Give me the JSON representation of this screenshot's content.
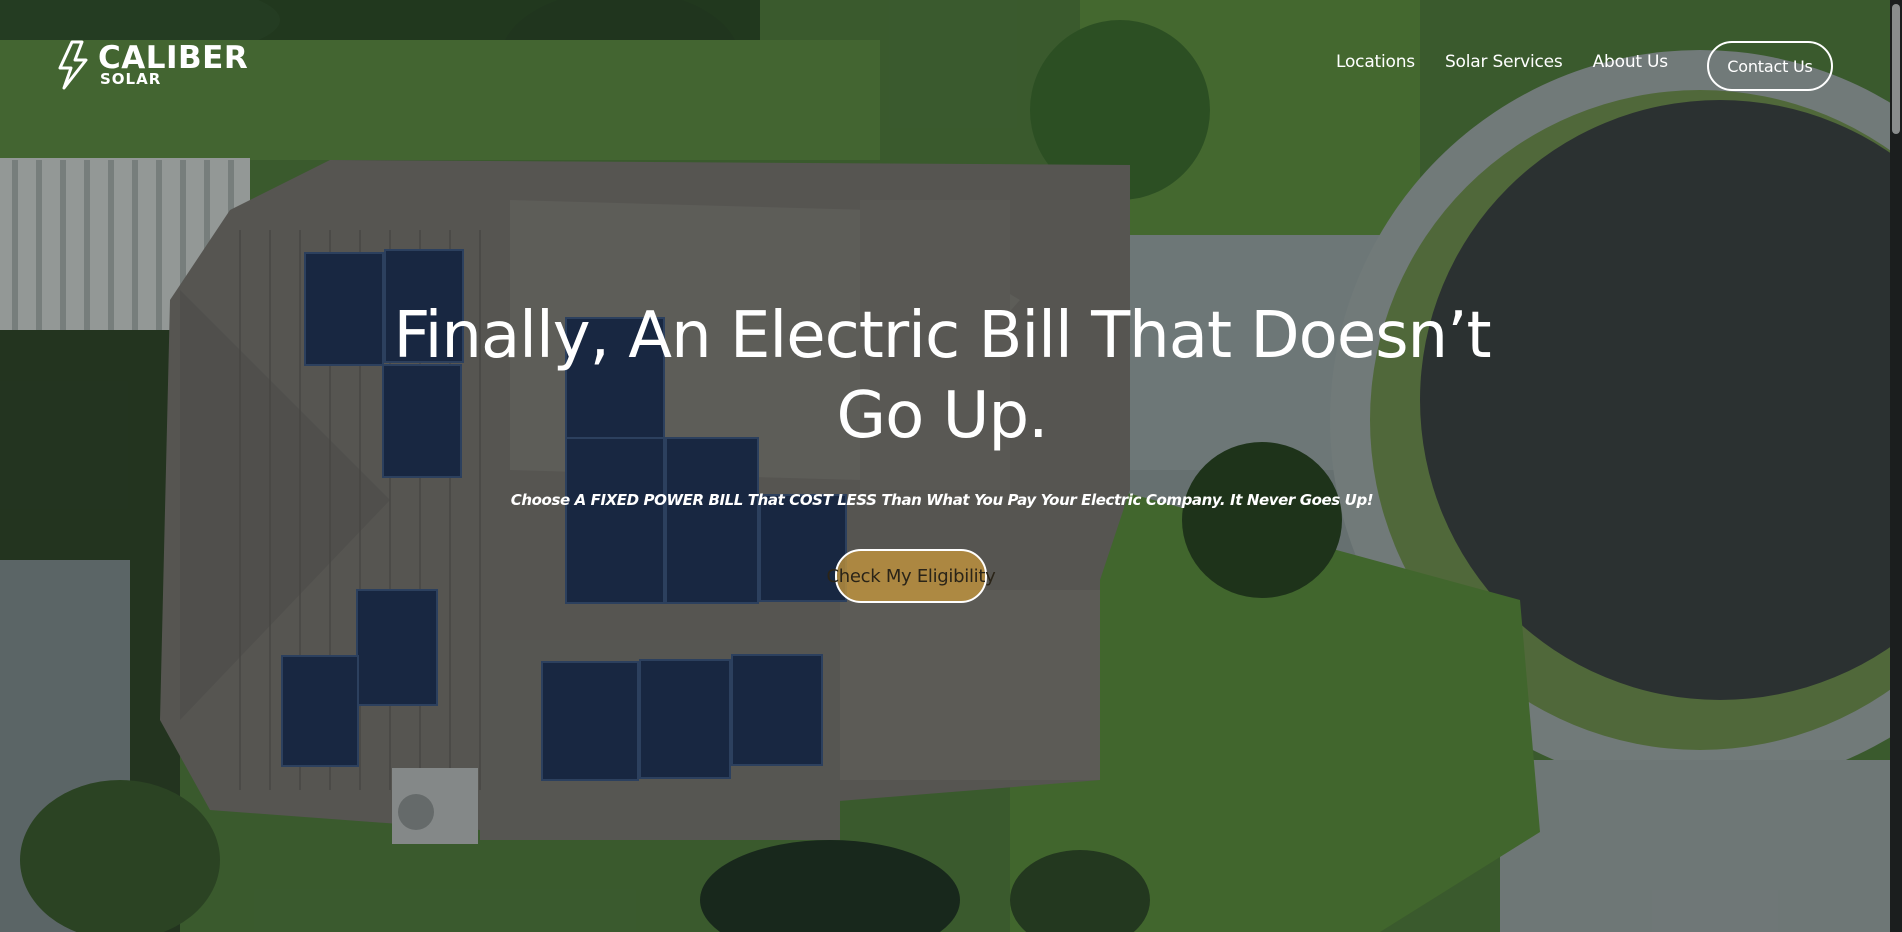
{
  "brand": {
    "name": "CALIBER",
    "tagline": "SOLAR",
    "logo_icon": "lightning-bolt-icon"
  },
  "nav": {
    "items": [
      {
        "label": "Locations"
      },
      {
        "label": "Solar Services"
      },
      {
        "label": "About Us"
      }
    ],
    "contact_label": "Contact Us"
  },
  "hero": {
    "title": "Finally, An Electric Bill That Doesn’t Go Up.",
    "subtitle": "Choose A FIXED POWER BILL That COST LESS Than What You Pay Your Electric Company. It Never Goes Up!",
    "cta_label": "Check My Eligibility"
  },
  "colors": {
    "text": "#ffffff",
    "cta_fill": "#c4963c",
    "overlay": "#0a1012"
  }
}
